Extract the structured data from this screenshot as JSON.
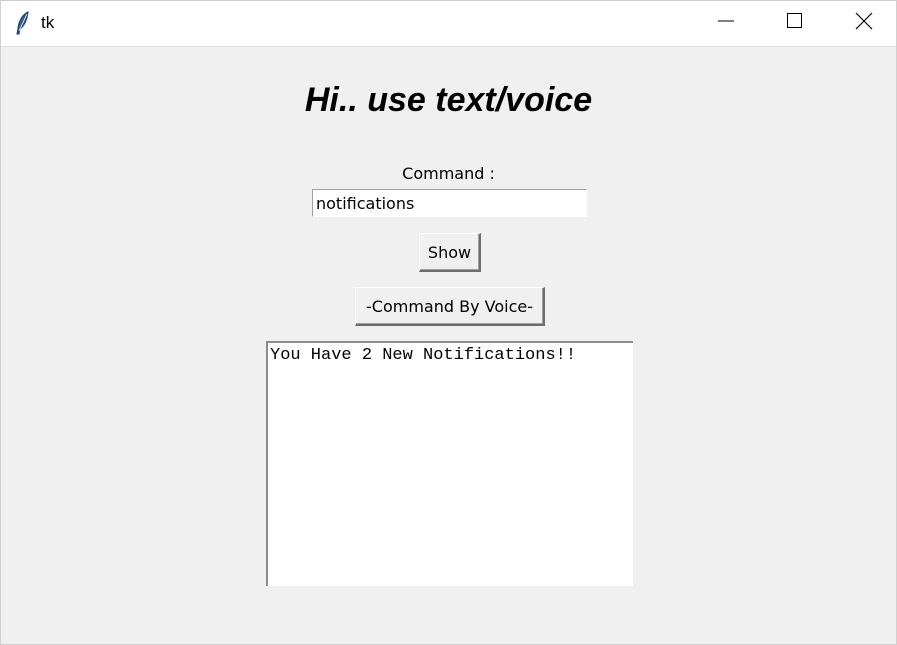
{
  "window": {
    "title": "tk",
    "controls": {
      "minimize_icon": "minimize-icon",
      "maximize_icon": "maximize-icon",
      "close_icon": "close-icon"
    }
  },
  "main": {
    "heading": "Hi.. use text/voice",
    "command_label": "Command :",
    "command_value": "notifications",
    "show_button": "Show",
    "voice_button": "-Command By Voice-",
    "output_text": "You Have 2 New Notifications!!"
  },
  "colors": {
    "background": "#f0f0f0",
    "titlebar": "#ffffff",
    "text": "#000000"
  }
}
